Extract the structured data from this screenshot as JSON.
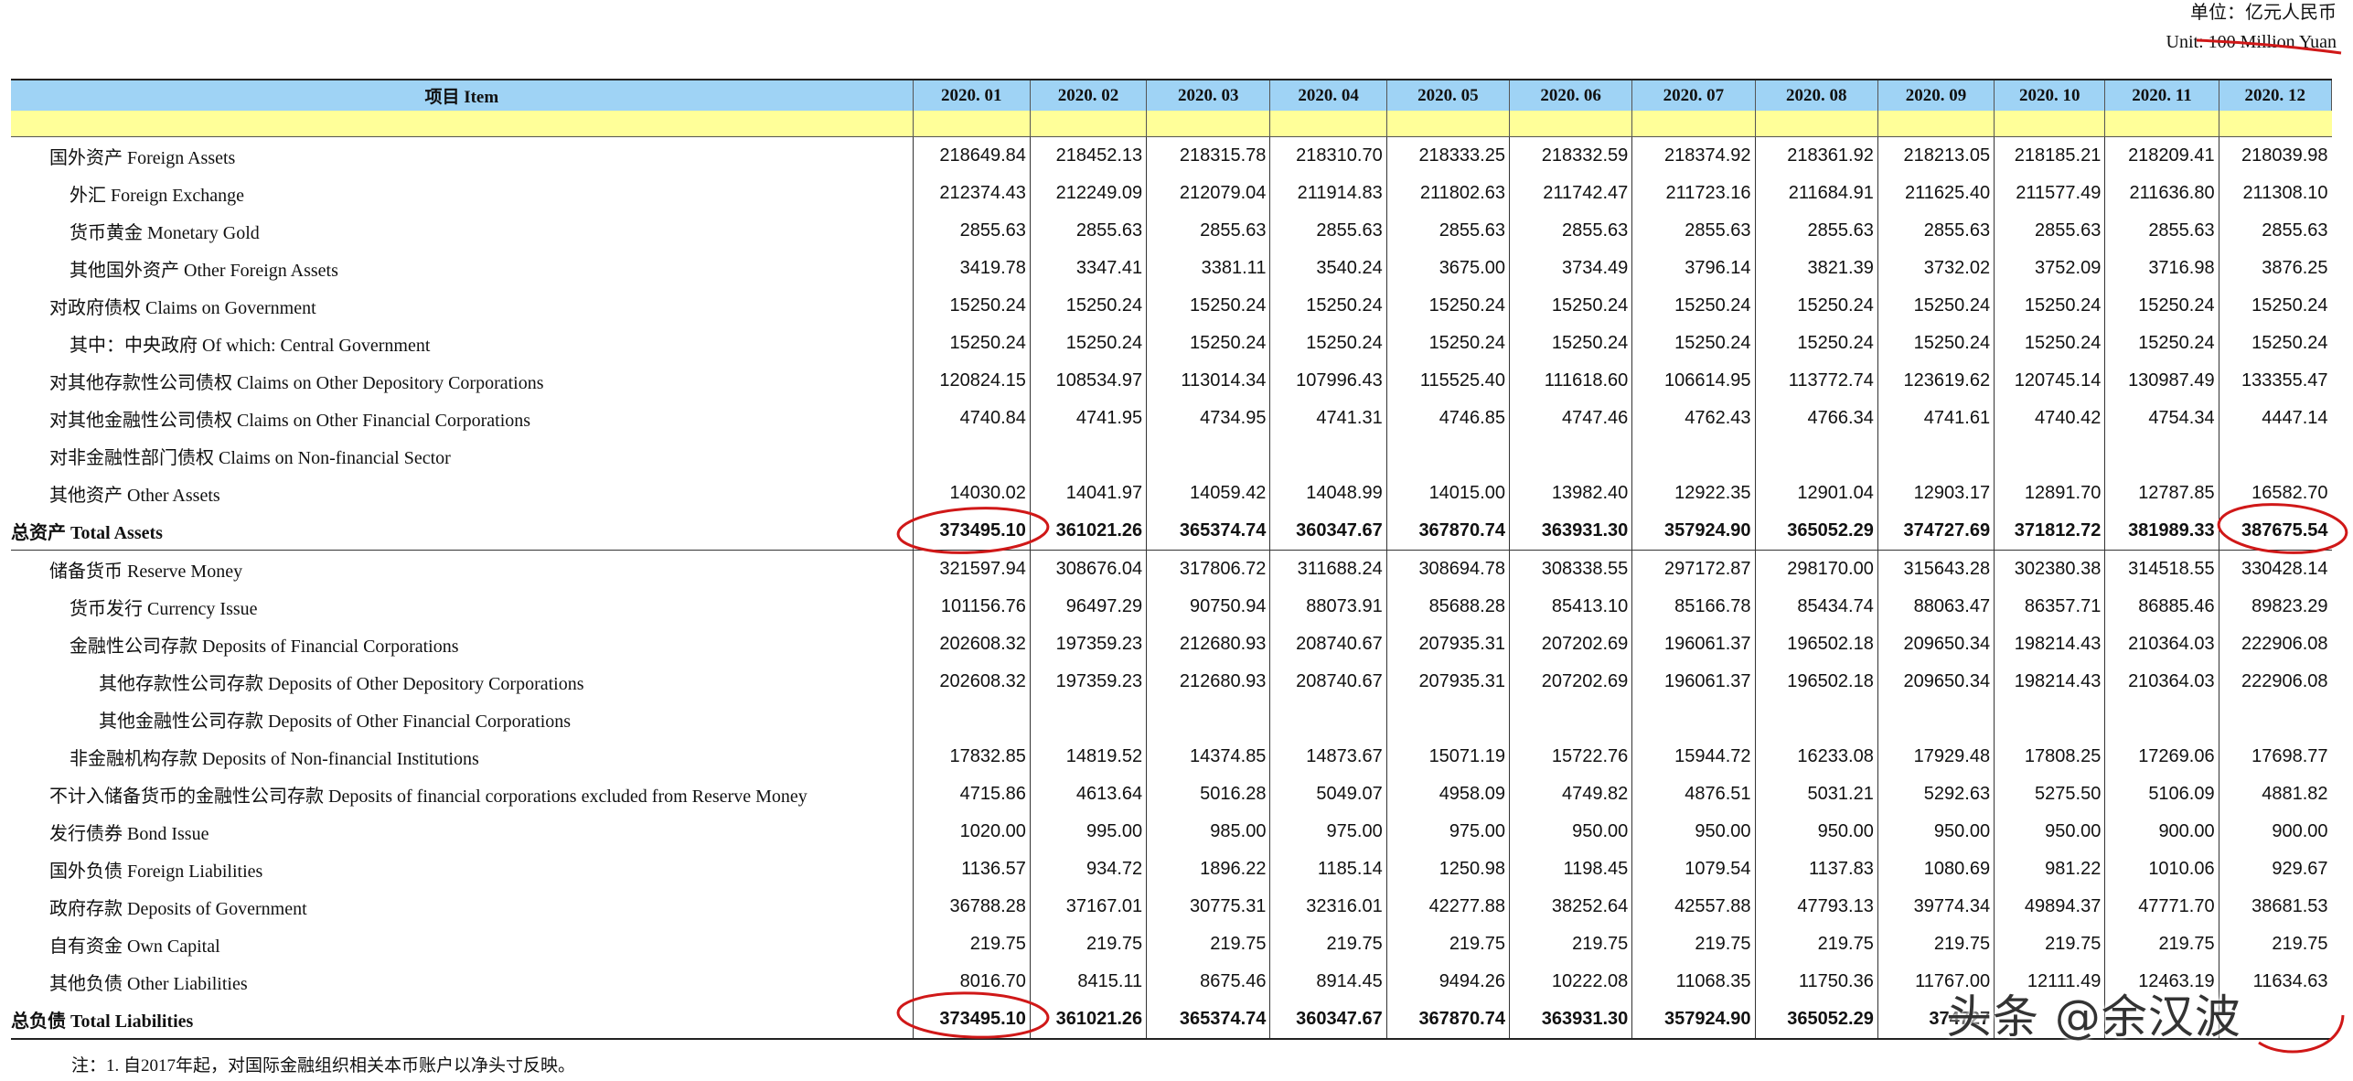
{
  "unit": {
    "cn": "单位：亿元人民币",
    "en": "Unit: 100 Million Yuan"
  },
  "table": {
    "item_header": "项目 Item",
    "months": [
      "2020. 01",
      "2020. 02",
      "2020. 03",
      "2020. 04",
      "2020. 05",
      "2020. 06",
      "2020. 07",
      "2020. 08",
      "2020. 09",
      "2020. 10",
      "2020. 11",
      "2020. 12"
    ],
    "rows": [
      {
        "label": "国外资产   Foreign Assets",
        "level": 1,
        "values": [
          "218649.84",
          "218452.13",
          "218315.78",
          "218310.70",
          "218333.25",
          "218332.59",
          "218374.92",
          "218361.92",
          "218213.05",
          "218185.21",
          "218209.41",
          "218039.98"
        ]
      },
      {
        "label": "外汇  Foreign Exchange",
        "level": 2,
        "values": [
          "212374.43",
          "212249.09",
          "212079.04",
          "211914.83",
          "211802.63",
          "211742.47",
          "211723.16",
          "211684.91",
          "211625.40",
          "211577.49",
          "211636.80",
          "211308.10"
        ]
      },
      {
        "label": "货币黄金  Monetary Gold",
        "level": 2,
        "values": [
          "2855.63",
          "2855.63",
          "2855.63",
          "2855.63",
          "2855.63",
          "2855.63",
          "2855.63",
          "2855.63",
          "2855.63",
          "2855.63",
          "2855.63",
          "2855.63"
        ]
      },
      {
        "label": "其他国外资产  Other Foreign Assets",
        "level": 2,
        "values": [
          "3419.78",
          "3347.41",
          "3381.11",
          "3540.24",
          "3675.00",
          "3734.49",
          "3796.14",
          "3821.39",
          "3732.02",
          "3752.09",
          "3716.98",
          "3876.25"
        ]
      },
      {
        "label": "对政府债权  Claims on Government",
        "level": 1,
        "values": [
          "15250.24",
          "15250.24",
          "15250.24",
          "15250.24",
          "15250.24",
          "15250.24",
          "15250.24",
          "15250.24",
          "15250.24",
          "15250.24",
          "15250.24",
          "15250.24"
        ]
      },
      {
        "label": "其中：中央政府   Of which: Central Government",
        "level": 2,
        "values": [
          "15250.24",
          "15250.24",
          "15250.24",
          "15250.24",
          "15250.24",
          "15250.24",
          "15250.24",
          "15250.24",
          "15250.24",
          "15250.24",
          "15250.24",
          "15250.24"
        ]
      },
      {
        "label": "对其他存款性公司债权  Claims on Other Depository Corporations",
        "level": 1,
        "values": [
          "120824.15",
          "108534.97",
          "113014.34",
          "107996.43",
          "115525.40",
          "111618.60",
          "106614.95",
          "113772.74",
          "123619.62",
          "120745.14",
          "130987.49",
          "133355.47"
        ]
      },
      {
        "label": "对其他金融性公司债权  Claims on Other Financial Corporations",
        "level": 1,
        "values": [
          "4740.84",
          "4741.95",
          "4734.95",
          "4741.31",
          "4746.85",
          "4747.46",
          "4762.43",
          "4766.34",
          "4741.61",
          "4740.42",
          "4754.34",
          "4447.14"
        ]
      },
      {
        "label": "对非金融性部门债权  Claims on Non-financial Sector",
        "level": 1,
        "values": [
          "",
          "",
          "",
          "",
          "",
          "",
          "",
          "",
          "",
          "",
          "",
          ""
        ]
      },
      {
        "label": "其他资产   Other Assets",
        "level": 1,
        "values": [
          "14030.02",
          "14041.97",
          "14059.42",
          "14048.99",
          "14015.00",
          "13982.40",
          "12922.35",
          "12901.04",
          "12903.17",
          "12891.70",
          "12787.85",
          "16582.70"
        ]
      },
      {
        "label": "总资产  Total Assets",
        "level": 0,
        "total": "assets",
        "values": [
          "373495.10",
          "361021.26",
          "365374.74",
          "360347.67",
          "367870.74",
          "363931.30",
          "357924.90",
          "365052.29",
          "374727.69",
          "371812.72",
          "381989.33",
          "387675.54"
        ]
      },
      {
        "label": "储备货币  Reserve Money",
        "level": 1,
        "values": [
          "321597.94",
          "308676.04",
          "317806.72",
          "311688.24",
          "308694.78",
          "308338.55",
          "297172.87",
          "298170.00",
          "315643.28",
          "302380.38",
          "314518.55",
          "330428.14"
        ]
      },
      {
        "label": "货币发行  Currency Issue",
        "level": 2,
        "values": [
          "101156.76",
          "96497.29",
          "90750.94",
          "88073.91",
          "85688.28",
          "85413.10",
          "85166.78",
          "85434.74",
          "88063.47",
          "86357.71",
          "86885.46",
          "89823.29"
        ]
      },
      {
        "label": "金融性公司存款  Deposits of Financial Corporations",
        "level": 2,
        "values": [
          "202608.32",
          "197359.23",
          "212680.93",
          "208740.67",
          "207935.31",
          "207202.69",
          "196061.37",
          "196502.18",
          "209650.34",
          "198214.43",
          "210364.03",
          "222906.08"
        ]
      },
      {
        "label": "其他存款性公司存款  Deposits of  Other Depository Corporations",
        "level": 3,
        "values": [
          "202608.32",
          "197359.23",
          "212680.93",
          "208740.67",
          "207935.31",
          "207202.69",
          "196061.37",
          "196502.18",
          "209650.34",
          "198214.43",
          "210364.03",
          "222906.08"
        ]
      },
      {
        "label": "其他金融性公司存款  Deposits of  Other Financial Corporations",
        "level": 3,
        "values": [
          "",
          "",
          "",
          "",
          "",
          "",
          "",
          "",
          "",
          "",
          "",
          ""
        ]
      },
      {
        "label": "非金融机构存款 Deposits of  Non-financial Institutions",
        "level": 2,
        "values": [
          "17832.85",
          "14819.52",
          "14374.85",
          "14873.67",
          "15071.19",
          "15722.76",
          "15944.72",
          "16233.08",
          "17929.48",
          "17808.25",
          "17269.06",
          "17698.77"
        ]
      },
      {
        "label": "不计入储备货币的金融性公司存款  Deposits of financial corporations excluded from Reserve Money",
        "level": 1,
        "values": [
          "4715.86",
          "4613.64",
          "5016.28",
          "5049.07",
          "4958.09",
          "4749.82",
          "4876.51",
          "5031.21",
          "5292.63",
          "5275.50",
          "5106.09",
          "4881.82"
        ]
      },
      {
        "label": "发行债券  Bond Issue",
        "level": 1,
        "values": [
          "1020.00",
          "995.00",
          "985.00",
          "975.00",
          "975.00",
          "950.00",
          "950.00",
          "950.00",
          "950.00",
          "950.00",
          "900.00",
          "900.00"
        ]
      },
      {
        "label": "国外负债  Foreign Liabilities",
        "level": 1,
        "values": [
          "1136.57",
          "934.72",
          "1896.22",
          "1185.14",
          "1250.98",
          "1198.45",
          "1079.54",
          "1137.83",
          "1080.69",
          "981.22",
          "1010.06",
          "929.67"
        ]
      },
      {
        "label": "政府存款  Deposits of Government",
        "level": 1,
        "values": [
          "36788.28",
          "37167.01",
          "30775.31",
          "32316.01",
          "42277.88",
          "38252.64",
          "42557.88",
          "47793.13",
          "39774.34",
          "49894.37",
          "47771.70",
          "38681.53"
        ]
      },
      {
        "label": "自有资金  Own Capital",
        "level": 1,
        "values": [
          "219.75",
          "219.75",
          "219.75",
          "219.75",
          "219.75",
          "219.75",
          "219.75",
          "219.75",
          "219.75",
          "219.75",
          "219.75",
          "219.75"
        ]
      },
      {
        "label": "其他负债   Other Liabilities",
        "level": 1,
        "values": [
          "8016.70",
          "8415.11",
          "8675.46",
          "8914.45",
          "9494.26",
          "10222.08",
          "11068.35",
          "11750.36",
          "11767.00",
          "12111.49",
          "12463.19",
          "11634.63"
        ]
      },
      {
        "label": "总负债  Total  Liabilities",
        "level": 0,
        "total": "liab",
        "values": [
          "373495.10",
          "361021.26",
          "365374.74",
          "360347.67",
          "367870.74",
          "363931.30",
          "357924.90",
          "365052.29",
          "374727",
          "",
          "",
          ""
        ]
      }
    ]
  },
  "note": "注：1. 自2017年起，对国际金融组织相关本币账户以净头寸反映。",
  "watermark": "头条 @余汉波"
}
